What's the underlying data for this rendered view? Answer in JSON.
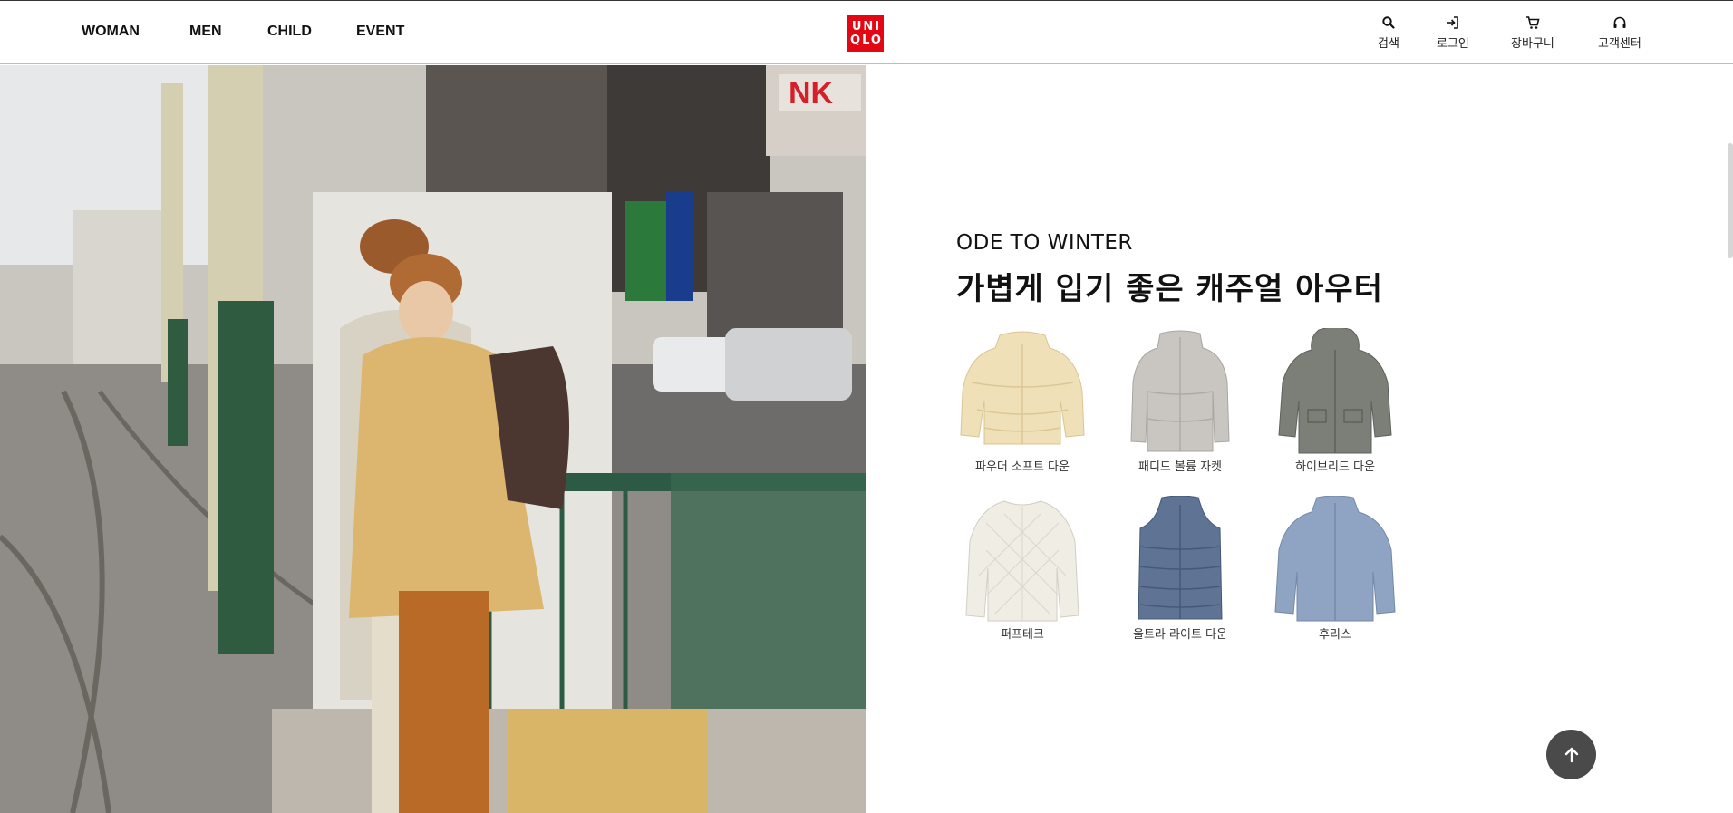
{
  "nav": {
    "items": [
      "WOMAN",
      "MEN",
      "CHILD",
      "EVENT"
    ]
  },
  "logo": {
    "line1": "UNI",
    "line2": "QLO",
    "brand_color": "#e30613"
  },
  "utility": {
    "search": {
      "label": "검색",
      "icon": "search-icon"
    },
    "login": {
      "label": "로그인",
      "icon": "login-icon"
    },
    "cart": {
      "label": "장바구니",
      "icon": "cart-icon"
    },
    "support": {
      "label": "고객센터",
      "icon": "headset-icon"
    }
  },
  "feature": {
    "subtitle": "ODE TO WINTER",
    "headline": "가볍게 입기 좋은 캐주얼 아우터"
  },
  "products": [
    {
      "name": "파우더 소프트 다운",
      "color": "#efe0b8"
    },
    {
      "name": "패디드 볼륨 자켓",
      "color": "#c9c6c2"
    },
    {
      "name": "하이브리드 다운",
      "color": "#7b7f78"
    },
    {
      "name": "퍼프테크",
      "color": "#f0ede4"
    },
    {
      "name": "울트라 라이트 다운",
      "color": "#5f7394"
    },
    {
      "name": "후리스",
      "color": "#8ea4c2"
    }
  ],
  "back_to_top": {
    "icon": "arrow-up-icon"
  }
}
